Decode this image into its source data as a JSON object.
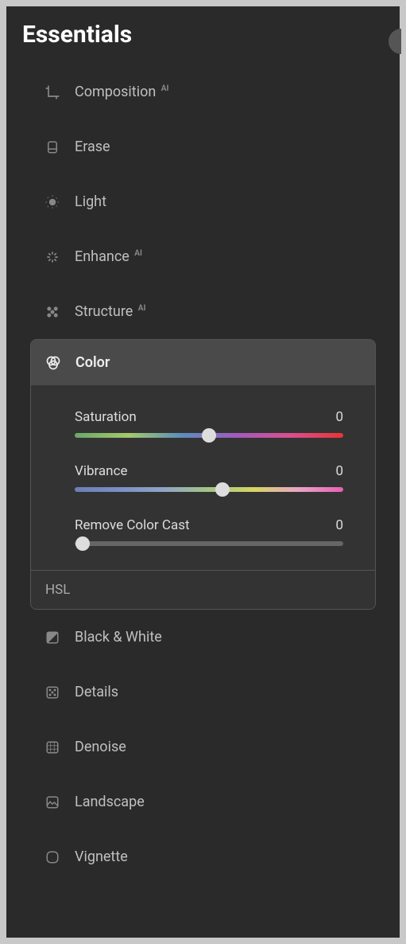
{
  "header": {
    "title": "Essentials"
  },
  "tools": {
    "composition": {
      "label": "Composition",
      "ai": "AI"
    },
    "erase": {
      "label": "Erase"
    },
    "light": {
      "label": "Light"
    },
    "enhance": {
      "label": "Enhance",
      "ai": "AI"
    },
    "structure": {
      "label": "Structure",
      "ai": "AI"
    },
    "color": {
      "label": "Color"
    },
    "blackwhite": {
      "label": "Black & White"
    },
    "details": {
      "label": "Details"
    },
    "denoise": {
      "label": "Denoise"
    },
    "landscape": {
      "label": "Landscape"
    },
    "vignette": {
      "label": "Vignette"
    }
  },
  "colorPanel": {
    "saturation": {
      "label": "Saturation",
      "value": "0"
    },
    "vibrance": {
      "label": "Vibrance",
      "value": "0"
    },
    "removeColorCast": {
      "label": "Remove Color Cast",
      "value": "0"
    },
    "hsl": {
      "label": "HSL"
    }
  }
}
